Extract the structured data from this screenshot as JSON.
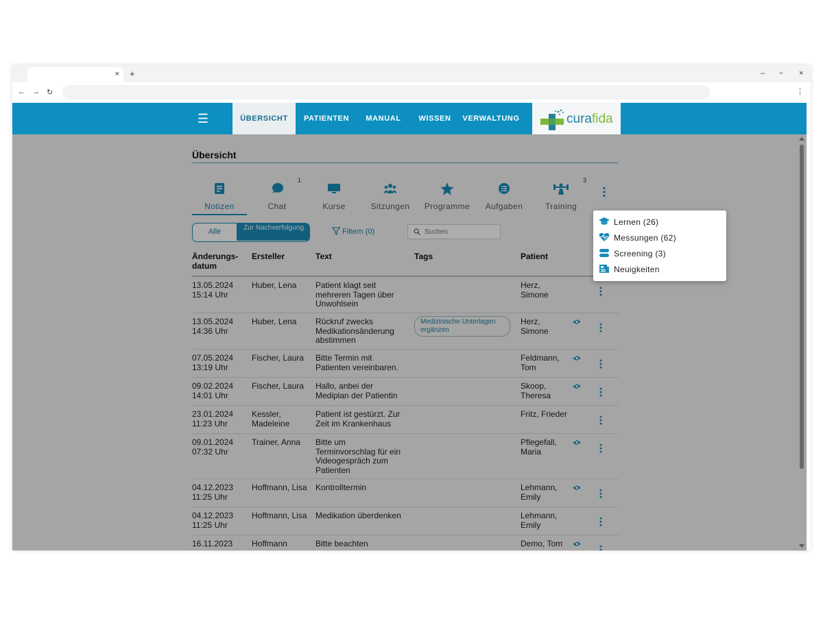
{
  "browser": {
    "tab_close": "×",
    "new_tab": "+",
    "controls": [
      "–",
      "▫",
      "×"
    ],
    "nav": [
      "←",
      "→",
      "↻"
    ],
    "menu": "⋮"
  },
  "nav": {
    "items": [
      {
        "label": "ÜBERSICHT",
        "active": true
      },
      {
        "label": "PATIENTEN",
        "active": false
      },
      {
        "label": "MANUAL",
        "active": false
      },
      {
        "label": "WISSEN",
        "active": false
      },
      {
        "label": "VERWALTUNG",
        "active": false
      }
    ],
    "logo_part1": "cura",
    "logo_part2": "fida"
  },
  "page": {
    "title": "Übersicht"
  },
  "categories": [
    {
      "label": "Notizen",
      "icon": "notes-icon",
      "badge": ""
    },
    {
      "label": "Chat",
      "icon": "chat-icon",
      "badge": "1"
    },
    {
      "label": "Kurse",
      "icon": "courses-icon",
      "badge": ""
    },
    {
      "label": "Sitzungen",
      "icon": "sessions-icon",
      "badge": ""
    },
    {
      "label": "Programme",
      "icon": "star-icon",
      "badge": ""
    },
    {
      "label": "Aufgaben",
      "icon": "tasks-icon",
      "badge": ""
    },
    {
      "label": "Training",
      "icon": "training-icon",
      "badge": "3"
    }
  ],
  "filterbar": {
    "toggle_all": "Alle",
    "toggle_followup": "Zur Nachverfolgung",
    "filter_label": "Filtern (0)",
    "search_placeholder": "Suchen"
  },
  "table": {
    "headers": {
      "date": "Änderungs-\ndatum",
      "creator": "Ersteller",
      "text": "Text",
      "tags": "Tags",
      "patient": "Patient"
    },
    "rows": [
      {
        "date": "13.05.2024\n15:14 Uhr",
        "creator": "Huber, Lena",
        "text": "Patient klagt seit\nmehreren Tagen über\nUnwohlsein",
        "tag": "",
        "patient": "Herz,\nSimone",
        "eye": false
      },
      {
        "date": "13.05.2024\n14:36 Uhr",
        "creator": "Huber, Lena",
        "text": "Rückruf zwecks\nMedikationsänderung\nabstimmen",
        "tag": "Medizinische Unterlagen ergänzen",
        "patient": "Herz,\nSimone",
        "eye": true
      },
      {
        "date": "07.05.2024\n13:19 Uhr",
        "creator": "Fischer, Laura",
        "text": "Bitte Termin mit\nPatienten vereinbaren.",
        "tag": "",
        "patient": "Feldmann,\nTom",
        "eye": true
      },
      {
        "date": "09.02.2024\n14:01 Uhr",
        "creator": "Fischer, Laura",
        "text": "Hallo, anbei der\nMediplan der Patientin",
        "tag": "",
        "patient": "Skoop,\nTheresa",
        "eye": true
      },
      {
        "date": "23.01.2024\n11:23 Uhr",
        "creator": "Kessler,\nMadeleine",
        "text": "Patient ist gestürzt. Zur\nZeit im Krankenhaus",
        "tag": "",
        "patient": "Fritz, Frieder",
        "eye": false
      },
      {
        "date": "09.01.2024\n07:32 Uhr",
        "creator": "Trainer, Anna",
        "text": "Bitte um\nTerminvorschlag für ein\nVideogespräch zum\nPatienten",
        "tag": "",
        "patient": "Pflegefall,\nMaria",
        "eye": true
      },
      {
        "date": "04.12.2023\n11:25 Uhr",
        "creator": "Hoffmann, Lisa",
        "text": "Kontrolltermin",
        "tag": "",
        "patient": "Lehmann,\nEmily",
        "eye": true
      },
      {
        "date": "04.12.2023\n11:25 Uhr",
        "creator": "Hoffmann, Lisa",
        "text": "Medikation überdenken",
        "tag": "",
        "patient": "Lehmann,\nEmily",
        "eye": false
      },
      {
        "date": "16.11.2023",
        "creator": "Hoffmann",
        "text": "Bitte beachten",
        "tag": "",
        "patient": "Demo, Tom",
        "eye": true
      }
    ]
  },
  "more_menu": [
    {
      "label": "Lernen (26)",
      "icon": "graduation-cap-icon"
    },
    {
      "label": "Messungen (62)",
      "icon": "heart-monitor-icon"
    },
    {
      "label": "Screening (3)",
      "icon": "screening-icon"
    },
    {
      "label": "Neuigkeiten",
      "icon": "newspaper-icon"
    }
  ],
  "colors": {
    "primary": "#0d8fc0",
    "accent_text": "#1a7ea8",
    "logo_green": "#7cb83a"
  }
}
